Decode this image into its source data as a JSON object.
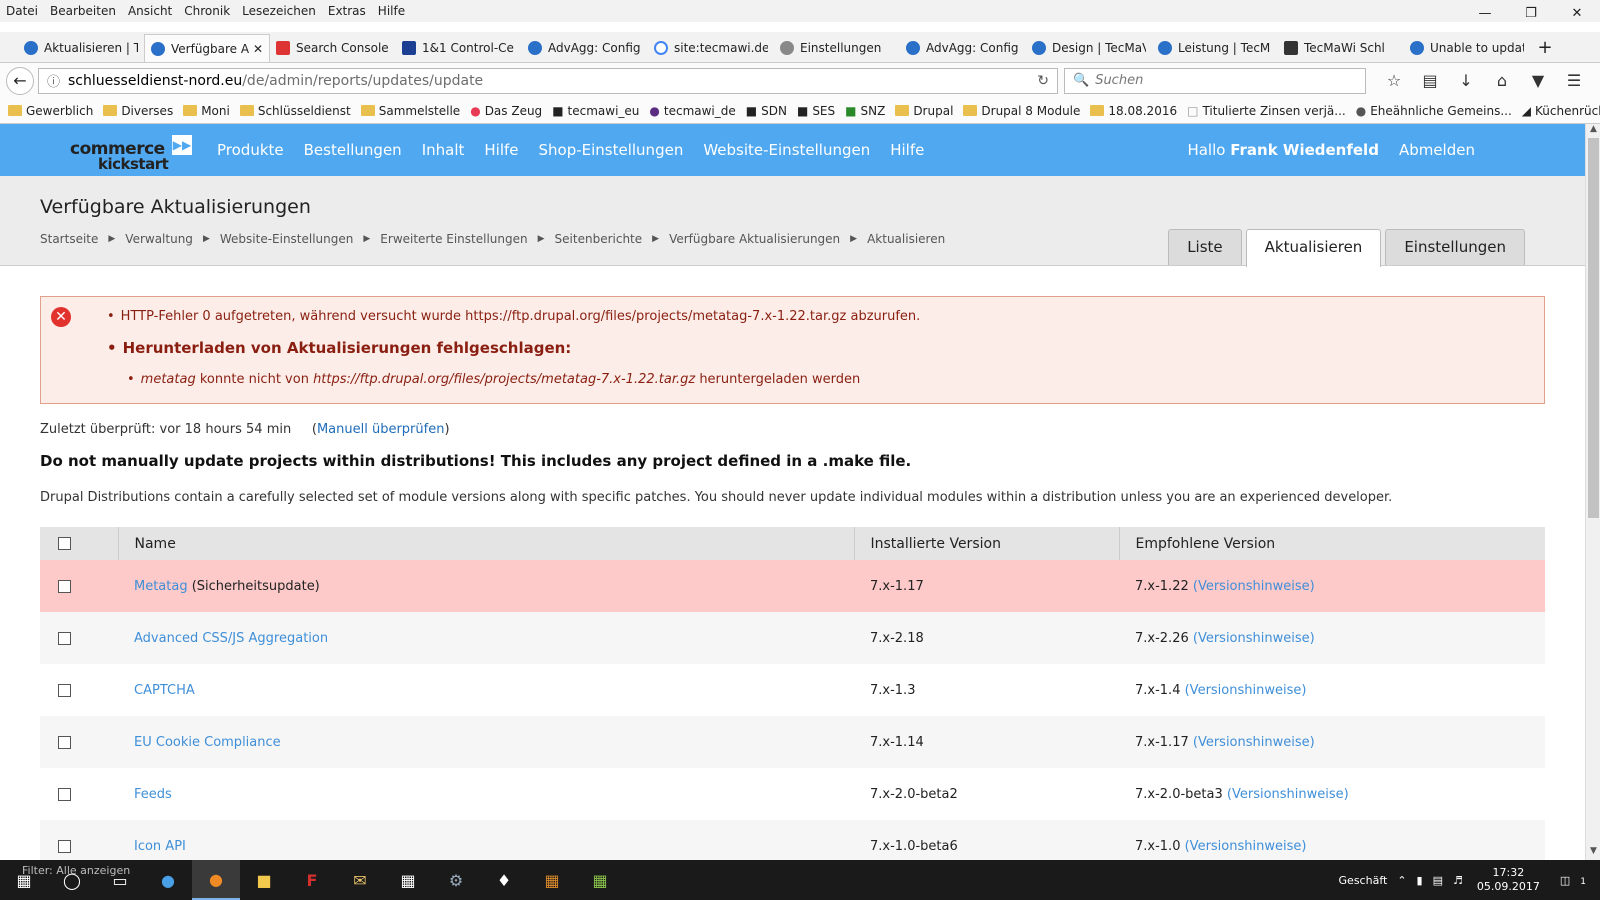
{
  "menubar": [
    "Datei",
    "Bearbeiten",
    "Ansicht",
    "Chronik",
    "Lesezeichen",
    "Extras",
    "Hilfe"
  ],
  "tabs": [
    {
      "label": "Aktualisieren | Te",
      "active": false
    },
    {
      "label": "Verfügbare A",
      "active": true
    },
    {
      "label": "Search Console",
      "active": false
    },
    {
      "label": "1&1 Control-Ce",
      "active": false
    },
    {
      "label": "AdvAgg: Config",
      "active": false
    },
    {
      "label": "site:tecmawi.de",
      "active": false
    },
    {
      "label": "Einstellungen",
      "active": false
    },
    {
      "label": "AdvAgg: Config",
      "active": false
    },
    {
      "label": "Design | TecMaV",
      "active": false
    },
    {
      "label": "Leistung | TecM",
      "active": false
    },
    {
      "label": "TecMaWi Schl",
      "active": false
    },
    {
      "label": "Unable to updat",
      "active": false
    }
  ],
  "url": {
    "host": "schluesseldienst-nord.eu",
    "path": "/de/admin/reports/updates/update"
  },
  "search": {
    "placeholder": "Suchen"
  },
  "bookmarks": [
    "Gewerblich",
    "Diverses",
    "Moni",
    "Schlüsseldienst",
    "Sammelstelle",
    "Das Zeug",
    "tecmawi_eu",
    "tecmawi_de",
    "SDN",
    "SES",
    "SNZ",
    "Drupal",
    "Drupal 8 Module",
    "18.08.2016",
    "Titulierte Zinsen verjä...",
    "Eheähnliche Gemeins...",
    "Küchenrückwand nac..."
  ],
  "admin": {
    "logo_line1": "commerce",
    "logo_line2": "kickstart",
    "nav": [
      "Produkte",
      "Bestellungen",
      "Inhalt",
      "Hilfe",
      "Shop-Einstellungen",
      "Website-Einstellungen",
      "Hilfe"
    ],
    "greeting": "Hallo",
    "username": "Frank Wiedenfeld",
    "logout": "Abmelden"
  },
  "page": {
    "title": "Verfügbare Aktualisierungen",
    "breadcrumbs": [
      "Startseite",
      "Verwaltung",
      "Website-Einstellungen",
      "Erweiterte Einstellungen",
      "Seitenberichte",
      "Verfügbare Aktualisierungen",
      "Aktualisieren"
    ],
    "tabs": [
      {
        "label": "Liste",
        "active": false
      },
      {
        "label": "Aktualisieren",
        "active": true
      },
      {
        "label": "Einstellungen",
        "active": false
      }
    ]
  },
  "error": {
    "line1": "HTTP-Fehler 0 aufgetreten, während versucht wurde https://ftp.drupal.org/files/projects/metatag-7.x-1.22.tar.gz abzurufen.",
    "line2": "Herunterladen von Aktualisierungen fehlgeschlagen:",
    "line3_module": "metatag",
    "line3_mid": " konnte nicht von ",
    "line3_url": "https://ftp.drupal.org/files/projects/metatag-7.x-1.22.tar.gz",
    "line3_end": " heruntergeladen werden"
  },
  "lastcheck": {
    "text": "Zuletzt überprüft: vor 18 hours 54 min",
    "link": "Manuell überprüfen"
  },
  "warning": "Do not manually update projects within distributions! This includes any project defined in a .make file.",
  "description": "Drupal Distributions contain a carefully selected set of module versions along with specific patches. You should never update individual modules within a distribution unless you are an experienced developer.",
  "table": {
    "headers": [
      "Name",
      "Installierte Version",
      "Empfohlene Version"
    ],
    "notes_label": "(Versionshinweise)",
    "rows": [
      {
        "name": "Metatag",
        "suffix": " (Sicherheitsupdate)",
        "installed": "7.x-1.17",
        "recommended": "7.x-1.22",
        "security": true
      },
      {
        "name": "Advanced CSS/JS Aggregation",
        "suffix": "",
        "installed": "7.x-2.18",
        "recommended": "7.x-2.26",
        "security": false
      },
      {
        "name": "CAPTCHA",
        "suffix": "",
        "installed": "7.x-1.3",
        "recommended": "7.x-1.4",
        "security": false
      },
      {
        "name": "EU Cookie Compliance",
        "suffix": "",
        "installed": "7.x-1.14",
        "recommended": "7.x-1.17",
        "security": false
      },
      {
        "name": "Feeds",
        "suffix": "",
        "installed": "7.x-2.0-beta2",
        "recommended": "7.x-2.0-beta3",
        "security": false
      },
      {
        "name": "Icon API",
        "suffix": "",
        "installed": "7.x-1.0-beta6",
        "recommended": "7.x-1.0",
        "security": false
      }
    ]
  },
  "taskbar": {
    "filter_hint": "Filter: Alle anzeigen",
    "tray_label": "Geschäft",
    "time": "17:32",
    "date": "05.09.2017",
    "notifications": "1"
  }
}
